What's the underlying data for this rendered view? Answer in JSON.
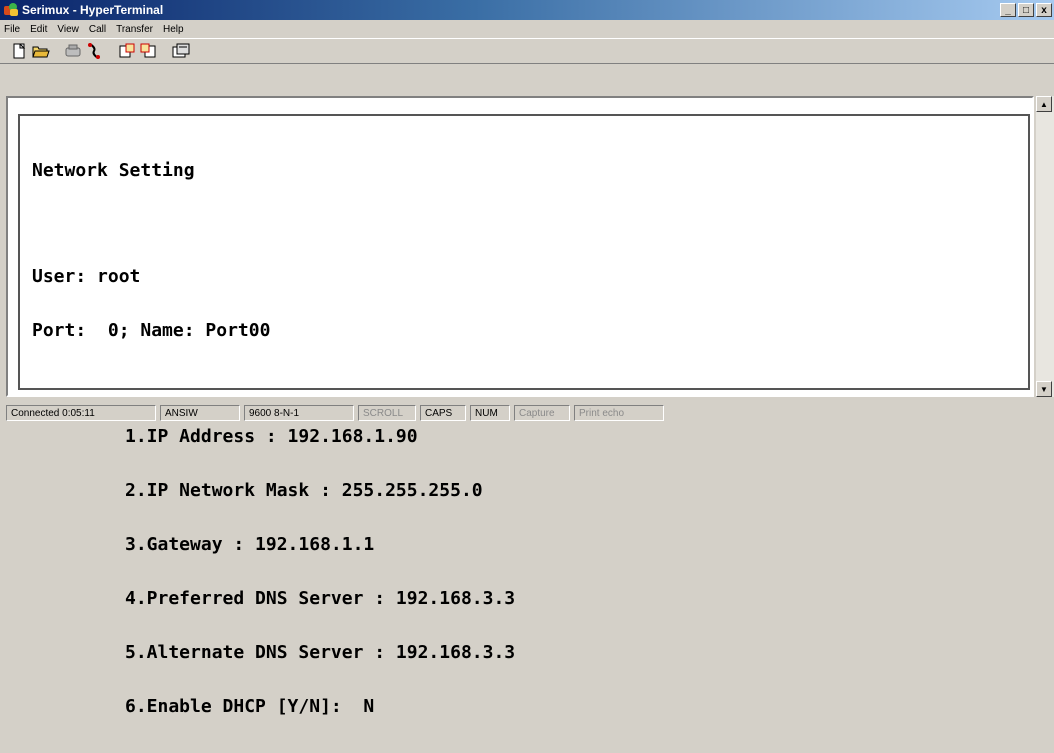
{
  "window": {
    "title": "Serimux - HyperTerminal",
    "controls": {
      "minimize": "_",
      "maximize": "□",
      "close": "x"
    }
  },
  "menu": {
    "items": [
      "File",
      "Edit",
      "View",
      "Call",
      "Transfer",
      "Help"
    ]
  },
  "toolbar": {
    "icons": [
      "new-icon",
      "open-icon",
      "call-icon",
      "disconnect-icon",
      "send-icon",
      "receive-icon",
      "properties-icon"
    ]
  },
  "terminal": {
    "heading": "Network Setting",
    "user_line": "User: root",
    "port_line": "Port:  0; Name: Port00",
    "options": [
      "1.IP Address : 192.168.1.90",
      "2.IP Network Mask : 255.255.255.0",
      "3.Gateway : 192.168.1.1",
      "4.Preferred DNS Server : 192.168.3.3",
      "5.Alternate DNS Server : 192.168.3.3",
      "6.Enable DHCP [Y/N]:  N"
    ]
  },
  "scrollbar": {
    "up": "▲",
    "down": "▼"
  },
  "status": {
    "connected": "Connected 0:05:11",
    "emulation": "ANSIW",
    "port_settings": "9600 8-N-1",
    "scroll": "SCROLL",
    "caps": "CAPS",
    "num": "NUM",
    "capture": "Capture",
    "print_echo": "Print echo"
  }
}
